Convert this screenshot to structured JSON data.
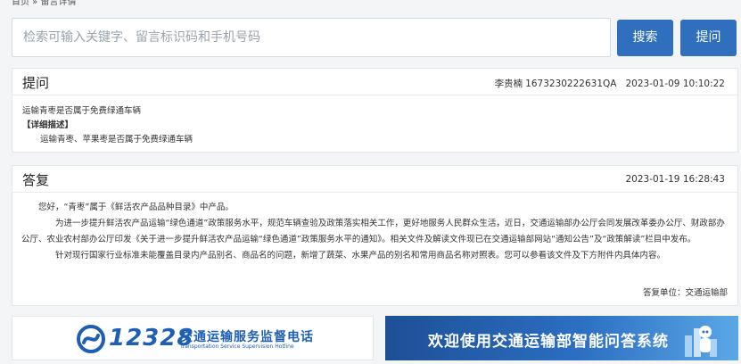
{
  "breadcrumb": "首页 » 留言详情",
  "search": {
    "placeholder": "检索可输入关键字、留言标识码和手机号码",
    "search_label": "搜索",
    "ask_label": "提问"
  },
  "question": {
    "heading": "提问",
    "author": "李贵楠",
    "code": "1673230222631QA",
    "time": "2023-01-09 10:10:22",
    "title": "运输青枣是否属于免费绿通车辆",
    "detail_label": "【详细描述】",
    "detail": "运输青枣、苹果枣是否属于免费绿通车辆"
  },
  "answer": {
    "heading": "答复",
    "time": "2023-01-19 16:28:43",
    "p1": "您好，“青枣”属于《鲜活农产品品种目录》中产品。",
    "p2": "为进一步提升鲜活农产品运输“绿色通道”政策服务水平，规范车辆查验及政策落实相关工作，更好地服务人民群众生活，近日，交通运输部办公厅会同发展改革委办公厅、财政部办公厅、农业农村部办公厅印发《关于进一步提升鲜活农产品运输“绿色通道”政策服务水平的通知》。相关文件及解读文件现已在交通运输部网站“通知公告”及“政策解读”栏目中发布。",
    "p3": "针对现行国家行业标准未能覆盖目录内产品别名、商品名的问题，新增了蔬菜、水果产品的别名和常用商品名称对照表。您可以参看该文件及下方附件内具体内容。",
    "signature": "答复单位：交通运输部"
  },
  "banners": {
    "hotline_number": "12328",
    "hotline_cn": "交通运输服务监督电话",
    "hotline_en": "Transportation Service Supervision Hotline",
    "assistant_text": "欢迎使用交通运输部智能问答系统"
  },
  "colors": {
    "primary": "#2f6fbe",
    "brand_blue": "#1e5fb4"
  }
}
